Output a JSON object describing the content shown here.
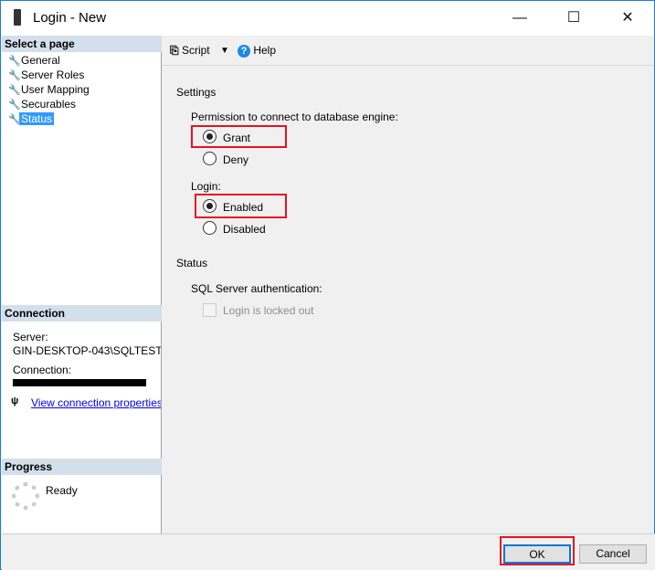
{
  "window": {
    "title": "Login - New",
    "minimize": "—",
    "maximize": "☐",
    "close": "✕"
  },
  "sidebar": {
    "header": "Select a page",
    "items": [
      {
        "label": "General"
      },
      {
        "label": "Server Roles"
      },
      {
        "label": "User Mapping"
      },
      {
        "label": "Securables"
      },
      {
        "label": "Status",
        "selected": true
      }
    ]
  },
  "connection": {
    "header": "Connection",
    "server_label": "Server:",
    "server_value": "GIN-DESKTOP-043\\SQLTEST",
    "connection_label": "Connection:",
    "view_link": "View connection properties"
  },
  "progress": {
    "header": "Progress",
    "status": "Ready"
  },
  "toolbar": {
    "script": "Script",
    "help": "Help"
  },
  "settings": {
    "heading": "Settings",
    "permission_label": "Permission to connect to database engine:",
    "grant": "Grant",
    "deny": "Deny",
    "permission_value": "Grant",
    "login_label": "Login:",
    "enabled": "Enabled",
    "disabled": "Disabled",
    "login_value": "Enabled"
  },
  "status": {
    "heading": "Status",
    "auth_label": "SQL Server authentication:",
    "locked_out": "Login is locked out",
    "locked_out_checked": false
  },
  "buttons": {
    "ok": "OK",
    "cancel": "Cancel"
  },
  "colors": {
    "highlight": "#e81123",
    "selection": "#3399ff",
    "link": "#0000ee"
  }
}
